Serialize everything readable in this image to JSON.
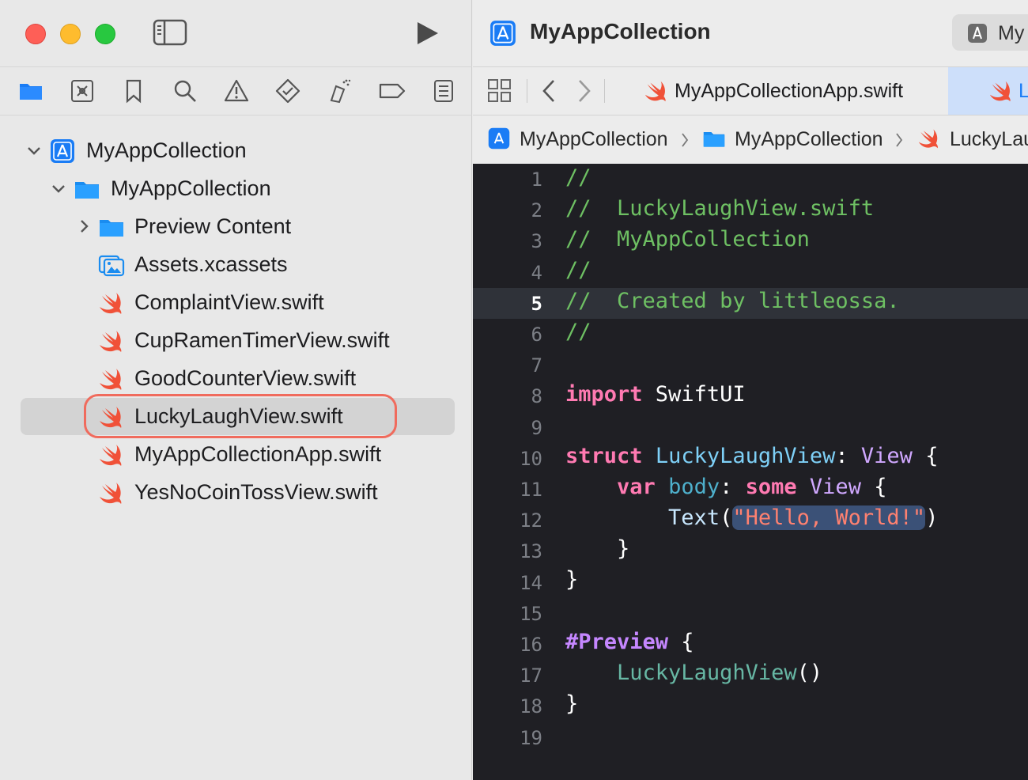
{
  "sidebar": {
    "nav_icons": [
      "folder-icon",
      "source-control-icon",
      "bookmark-icon",
      "search-icon",
      "warning-icon",
      "test-icon",
      "debug-icon",
      "breakpoint-icon",
      "report-icon"
    ],
    "tree": [
      {
        "label": "MyAppCollection",
        "kind": "project",
        "expanded": true
      },
      {
        "label": "MyAppCollection",
        "kind": "folder",
        "expanded": true
      },
      {
        "label": "Preview Content",
        "kind": "folder",
        "expanded": false
      },
      {
        "label": "Assets.xcassets",
        "kind": "assets"
      },
      {
        "label": "ComplaintView.swift",
        "kind": "swift"
      },
      {
        "label": "CupRamenTimerView.swift",
        "kind": "swift"
      },
      {
        "label": "GoodCounterView.swift",
        "kind": "swift"
      },
      {
        "label": "LuckyLaughView.swift",
        "kind": "swift",
        "selected": true
      },
      {
        "label": "MyAppCollectionApp.swift",
        "kind": "swift"
      },
      {
        "label": "YesNoCoinTossView.swift",
        "kind": "swift"
      }
    ]
  },
  "toolbar": {
    "project_title": "MyAppCollection",
    "scheme_label": "My"
  },
  "tabs": [
    {
      "label": "MyAppCollectionApp.swift",
      "active": false
    },
    {
      "label": "L",
      "active": true
    }
  ],
  "breadcrumb": [
    "MyAppCollection",
    "MyAppCollection",
    "LuckyLau"
  ],
  "editor": {
    "current_line": 5,
    "line_numbers": [
      "1",
      "2",
      "3",
      "4",
      "5",
      "6",
      "7",
      "8",
      "9",
      "10",
      "11",
      "12",
      "13",
      "14",
      "15",
      "16",
      "17",
      "18",
      "19"
    ],
    "code": {
      "l1": "//",
      "l2": "//  LuckyLaughView.swift",
      "l3": "//  MyAppCollection",
      "l4": "//",
      "l5": "//  Created by littleossa.",
      "l6": "//",
      "l8_kw": "import",
      "l8_rest": " SwiftUI",
      "l10_kw": "struct",
      "l10_name": "LuckyLaughView",
      "l10_colon": ": ",
      "l10_type": "View",
      "l10_brace": " {",
      "l11_kw": "var",
      "l11_name": "body",
      "l11_colon": ": ",
      "l11_some": "some",
      "l11_type": "View",
      "l11_brace": " {",
      "l12_fn": "Text",
      "l12_open": "(",
      "l12_str": "\"Hello, World!\"",
      "l12_close": ")",
      "l13": "}",
      "l14": "}",
      "l16_macro": "#Preview",
      "l16_brace": " {",
      "l17_call": "LuckyLaughView",
      "l17_paren": "()",
      "l18": "}"
    }
  },
  "colors": {
    "close": "#fe5f57",
    "minimize": "#febc2e",
    "maximize": "#28c840",
    "accent_blue": "#1a7cf5",
    "swift_orange": "#f05138",
    "selection_ring": "#f06b5d"
  }
}
